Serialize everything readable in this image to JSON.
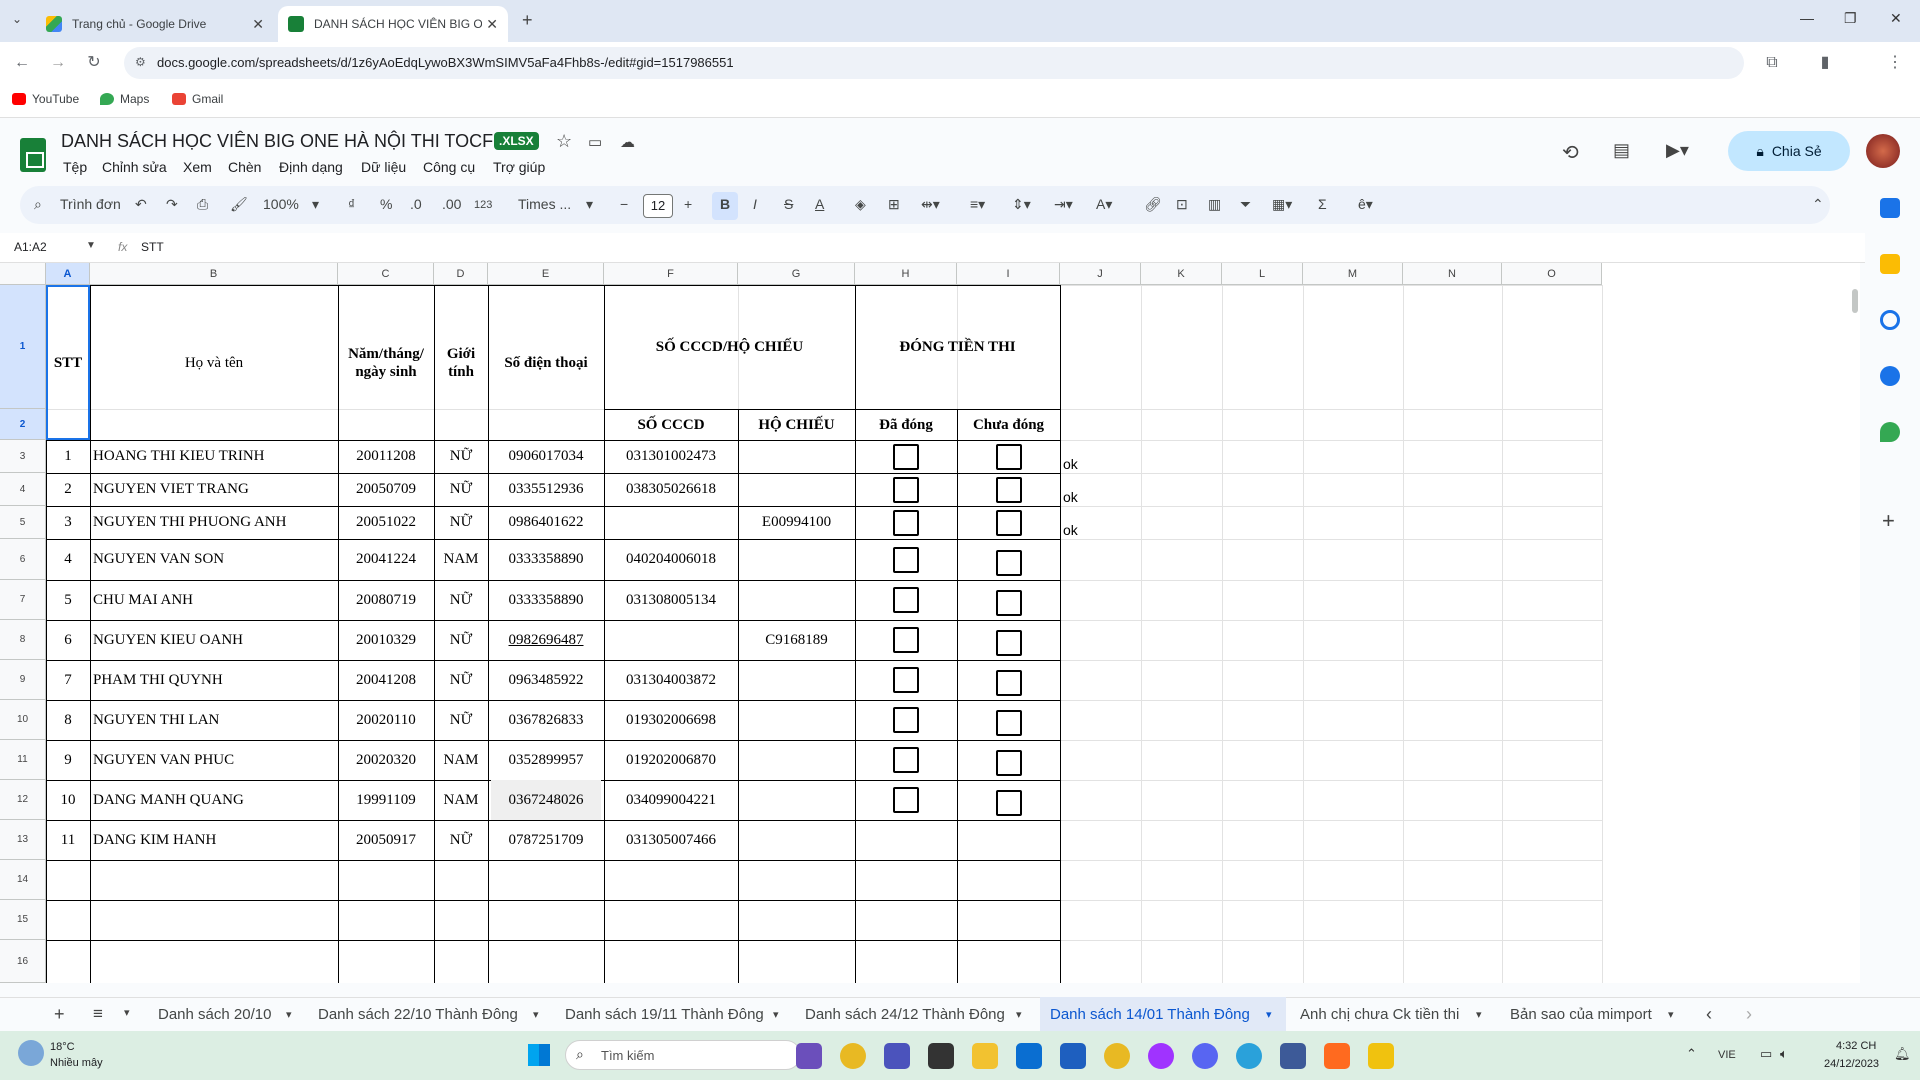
{
  "browser": {
    "tabs": [
      {
        "title": "Trang chủ - Google Drive",
        "icon": "google-drive-icon"
      },
      {
        "title": "DANH SÁCH HỌC VIÊN BIG ON",
        "icon": "google-sheets-icon"
      }
    ],
    "url": "docs.google.com/spreadsheets/d/1z6yAoEdqLywoBX3WmSIMV5aFa4Fhb8s-/edit#gid=1517986551",
    "bookmarks": [
      "YouTube",
      "Maps",
      "Gmail"
    ]
  },
  "doc": {
    "title": "DANH SÁCH HỌC VIÊN BIG ONE HÀ NỘI THI TOCFL",
    "badge": ".XLSX",
    "menu": [
      "Tệp",
      "Chỉnh sửa",
      "Xem",
      "Chèn",
      "Định dạng",
      "Dữ liệu",
      "Công cụ",
      "Trợ giúp"
    ],
    "share_label": "Chia Sẻ"
  },
  "toolbar": {
    "search": "Trình đơn",
    "zoom": "100%",
    "currency": "₫",
    "percent": "%",
    "dec_dec": ".0",
    "dec_inc": ".00",
    "num": "123",
    "font": "Times ...",
    "font_size": "12"
  },
  "formula": {
    "namebox": "A1:A2",
    "fx": "fx",
    "value": "STT"
  },
  "columns": [
    "A",
    "B",
    "C",
    "D",
    "E",
    "F",
    "G",
    "H",
    "I",
    "J",
    "K",
    "L",
    "M",
    "N",
    "O"
  ],
  "rows": [
    "1",
    "2",
    "3",
    "4",
    "5",
    "6",
    "7",
    "8",
    "9",
    "10",
    "11",
    "12",
    "13",
    "14",
    "15",
    "16"
  ],
  "headers": {
    "stt": "STT",
    "name": "Họ và tên",
    "dob": "Năm/tháng/ ngày sinh",
    "gender": "Giới tính",
    "phone": "Số điện thoại",
    "id_group": "SỐ CCCD/HỘ CHIẾU",
    "fee_group": "ĐÓNG TIỀN THI",
    "cccd": "SỐ CCCD",
    "passport": "HỘ CHIẾU",
    "paid": "Đã đóng",
    "unpaid": "Chưa đóng"
  },
  "students": [
    {
      "stt": "1",
      "name": "HOANG THI KIEU TRINH",
      "dob": "20011208",
      "gender": "NỮ",
      "phone": "0906017034",
      "cccd": "031301002473",
      "passport": "",
      "note": "ok",
      "checkbox": true
    },
    {
      "stt": "2",
      "name": "NGUYEN VIET TRANG",
      "dob": "20050709",
      "gender": "NỮ",
      "phone": "0335512936",
      "cccd": "038305026618",
      "passport": "",
      "note": "ok",
      "checkbox": true
    },
    {
      "stt": "3",
      "name": "NGUYEN THI PHUONG ANH",
      "dob": "20051022",
      "gender": "NỮ",
      "phone": "0986401622",
      "cccd": "",
      "passport": "E00994100",
      "note": "ok",
      "checkbox": true
    },
    {
      "stt": "4",
      "name": "NGUYEN VAN SON",
      "dob": "20041224",
      "gender": "NAM",
      "phone": "0333358890",
      "cccd": "040204006018",
      "passport": "",
      "note": "",
      "checkbox": true
    },
    {
      "stt": "5",
      "name": "CHU MAI ANH",
      "dob": "20080719",
      "gender": "NỮ",
      "phone": "0333358890",
      "cccd": "031308005134",
      "passport": "",
      "note": "",
      "checkbox": true
    },
    {
      "stt": "6",
      "name": "NGUYEN KIEU OANH",
      "dob": "20010329",
      "gender": "NỮ",
      "phone": "0982696487",
      "cccd": "",
      "passport": "C9168189",
      "note": "",
      "checkbox": true
    },
    {
      "stt": "7",
      "name": "PHAM THI QUYNH",
      "dob": "20041208",
      "gender": "NỮ",
      "phone": "0963485922",
      "cccd": "031304003872",
      "passport": "",
      "note": "",
      "checkbox": true
    },
    {
      "stt": "8",
      "name": "NGUYEN THI LAN",
      "dob": "20020110",
      "gender": "NỮ",
      "phone": "0367826833",
      "cccd": "019302006698",
      "passport": "",
      "note": "",
      "checkbox": true
    },
    {
      "stt": "9",
      "name": "NGUYEN VAN PHUC",
      "dob": "20020320",
      "gender": "NAM",
      "phone": "0352899957",
      "cccd": "019202006870",
      "passport": "",
      "note": "",
      "checkbox": true
    },
    {
      "stt": "10",
      "name": "DANG MANH QUANG",
      "dob": "19991109",
      "gender": "NAM",
      "phone": "0367248026",
      "cccd": "034099004221",
      "passport": "",
      "note": "",
      "checkbox": true
    },
    {
      "stt": "11",
      "name": "DANG KIM HANH",
      "dob": "20050917",
      "gender": "NỮ",
      "phone": "0787251709",
      "cccd": "031305007466",
      "passport": "",
      "note": "",
      "checkbox": false
    }
  ],
  "sheet_tabs": [
    "Danh sách 20/10",
    "Danh sách 22/10 Thành Đông",
    "Danh sách 19/11 Thành Đông",
    "Danh sách 24/12 Thành Đông",
    "Danh sách 14/01 Thành Đông",
    "Anh chị chưa Ck tiền thi",
    "Bản sao của mimport"
  ],
  "active_sheet": "Danh sách 14/01 Thành Đông",
  "taskbar": {
    "weather_temp": "18°C",
    "weather_desc": "Nhiều mây",
    "search": "Tìm kiếm",
    "lang": "VIE",
    "time": "4:32 CH",
    "date": "24/12/2023"
  },
  "colors": {
    "accent": "#0b57d0",
    "sheets_green": "#188038",
    "share_bg": "#c2e7ff"
  }
}
